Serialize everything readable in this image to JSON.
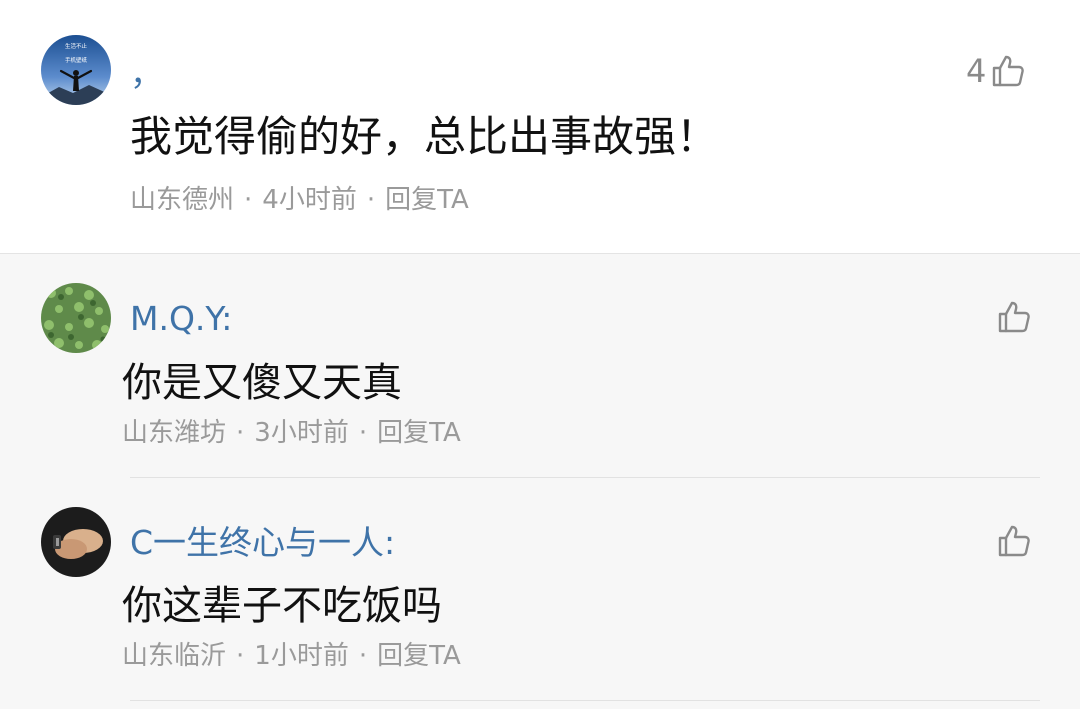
{
  "main_comment": {
    "username": "，",
    "content": "我觉得偷的好，总比出事故强！",
    "location": "山东德州",
    "time": "4小时前",
    "reply_label": "回复TA",
    "separator": "·",
    "like_count": "4",
    "avatar_text_line1": "生活不止",
    "avatar_text_line2": "手机壁纸"
  },
  "replies": [
    {
      "username": "M.Q.Y:",
      "content": "你是又傻又天真",
      "location": "山东潍坊",
      "time": "3小时前",
      "reply_label": "回复TA",
      "separator": "·"
    },
    {
      "username": "C一生终心与一人:",
      "content": "你这辈子不吃饭吗",
      "location": "山东临沂",
      "time": "1小时前",
      "reply_label": "回复TA",
      "separator": "·"
    }
  ],
  "icons": {
    "like": "thumbs-up-outline-icon"
  },
  "colors": {
    "username": "#3f73a8",
    "meta": "#9a9a9a",
    "reply_background": "#f7f7f7"
  }
}
